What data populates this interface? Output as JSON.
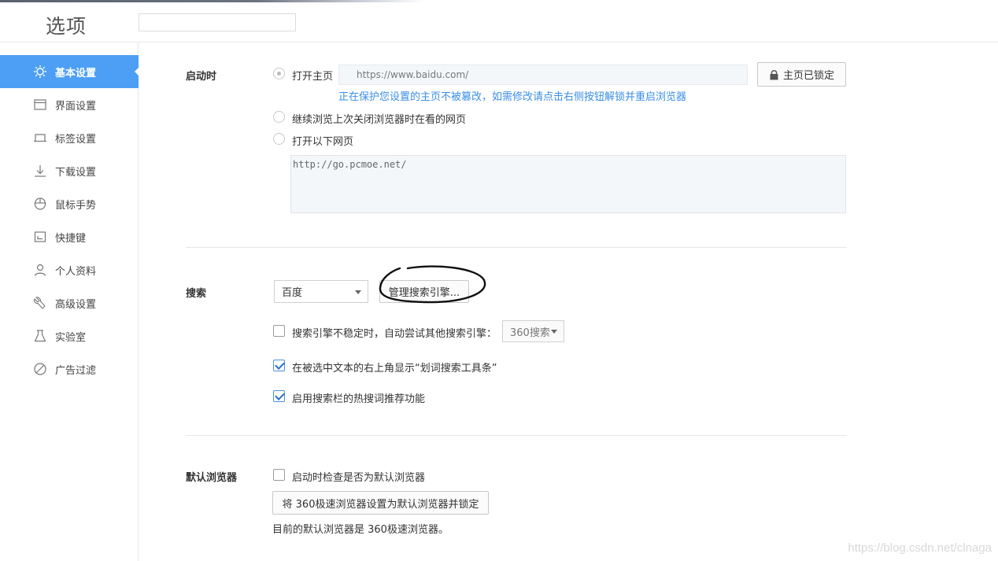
{
  "header": {
    "title": "选项",
    "search_placeholder": ""
  },
  "sidebar": {
    "items": [
      {
        "label": "基本设置",
        "icon": "sun-gear-icon",
        "active": true
      },
      {
        "label": "界面设置",
        "icon": "window-icon"
      },
      {
        "label": "标签设置",
        "icon": "tab-icon"
      },
      {
        "label": "下载设置",
        "icon": "download-icon"
      },
      {
        "label": "鼠标手势",
        "icon": "mouse-icon"
      },
      {
        "label": "快捷键",
        "icon": "keyboard-icon"
      },
      {
        "label": "个人资料",
        "icon": "user-icon"
      },
      {
        "label": "高级设置",
        "icon": "wrench-icon"
      },
      {
        "label": "实验室",
        "icon": "flask-icon"
      },
      {
        "label": "广告过滤",
        "icon": "block-icon"
      }
    ]
  },
  "startup": {
    "label": "启动时",
    "option_home": "打开主页",
    "home_url": "https://www.baidu.com/",
    "lock_button": "主页已锁定",
    "protect_hint": "正在保护您设置的主页不被篡改，如需修改请点击右侧按钮解锁并重启浏览器",
    "option_continue": "继续浏览上次关闭浏览器时在看的网页",
    "option_pages": "打开以下网页",
    "pages_text": "http://go.pcmoe.net/"
  },
  "search": {
    "label": "搜索",
    "engine_selected": "百度",
    "manage_button": "管理搜索引擎...",
    "fallback_label": "搜索引擎不稳定时，自动尝试其他搜索引擎：",
    "fallback_selected": "360搜索",
    "fallback_checked": false,
    "toolbar_label": "在被选中文本的右上角显示“划词搜索工具条”",
    "toolbar_checked": true,
    "hotword_label": "启用搜索栏的热搜词推荐功能",
    "hotword_checked": true
  },
  "default_browser": {
    "label": "默认浏览器",
    "check_label": "启动时检查是否为默认浏览器",
    "set_button": "将 360极速浏览器设置为默认浏览器并锁定",
    "status_text": "目前的默认浏览器是 360极速浏览器。"
  },
  "watermark": "https://blog.csdn.net/clnaga"
}
